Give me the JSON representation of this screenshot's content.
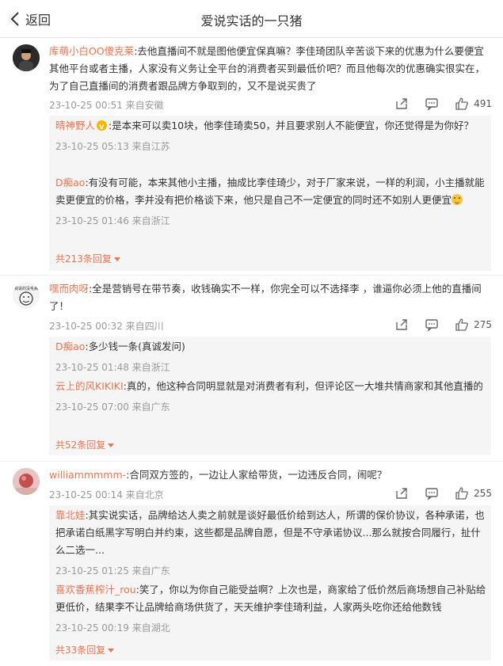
{
  "header": {
    "back_label": "返回",
    "title": "爱说实话的一只猪"
  },
  "comments": [
    {
      "user": "库萌小白OO傻克莱",
      "text": ":去他直播间不就是图他便宜保真嘛？李佳琦团队辛苦谈下来的优惠为什么要便宜其他平台或者主播，人家没有义务让全平台的消费者买到最低价吧？而且他每次的优惠确实很实在，为了自己直播间的消费者跟品牌方争取到的，又不是说买贵了",
      "meta": "23-10-25 00:51 来自安徽",
      "likes": "491",
      "replies": [
        {
          "user": "晴神野人",
          "text": ":是本来可以卖10块，他李佳琦卖50，并且要求别人不能便宜，你还觉得是为你好？",
          "meta": "23-10-25 05:13 来自江苏"
        },
        {
          "user": "D痴ao",
          "text": ":有没有可能，本来其他小主播，抽成比李佳琦少，对于厂家来说，一样的利润，小主播就能卖更便宜的价格，李并没有把价格谈下来，他只是自己不一定便宜的同时还不如别人更便宜",
          "meta": "23-10-25 01:46 来自浙江"
        }
      ],
      "more": "共213条回复"
    },
    {
      "user": "嘿而肉呀",
      "text": ":全是营销号在带节奏，收钱确实不一样，你完全可以不选择李 ，谁逼你必须上他的直播间了！",
      "meta": "23-10-25 00:32 来自四川",
      "likes": "275",
      "replies": [
        {
          "user": "D痴ao",
          "text": ":多少钱一条(真诚发问)",
          "meta": "23-10-25 01:48 来自浙江"
        },
        {
          "user": "云上的风KIKIKI",
          "text": ":真的，他这种合同明显就是对消费者有利，但评论区一大堆共情商家和其他直播的",
          "meta": "23-10-25 07:00 来自广东"
        }
      ],
      "more": "共52条回复"
    },
    {
      "user": "williammmmm-",
      "text": ":合同双方签的，一边让人家给带货，一边违反合同，闹呢？",
      "meta": "23-10-25 00:14 来自北京",
      "likes": "255",
      "replies": [
        {
          "user": "靠北娃",
          "text": ":其实说实话，品牌给达人卖之前就是谈好最低价给到达人，所谓的保价协议，各种承诺，也把承诺白纸黑字写明白并约束，这些都是品牌自愿，但是不守承诺协议...那么就按合同履行，扯什么二选一...",
          "meta": "23-10-25 01:25 来自广东"
        },
        {
          "user": "喜欢香蕉榨汁_rou",
          "text": ":笑了，你以为你自己能受益啊？上次也是，商家给了低价然后商场想自己补贴给更低价，结果李不让品牌给商场供货了，天天维护李佳琦利益，人家两头吃你还给他数钱",
          "meta": "23-10-25 00:19 来自湖北"
        }
      ],
      "more": "共33条回复"
    }
  ]
}
